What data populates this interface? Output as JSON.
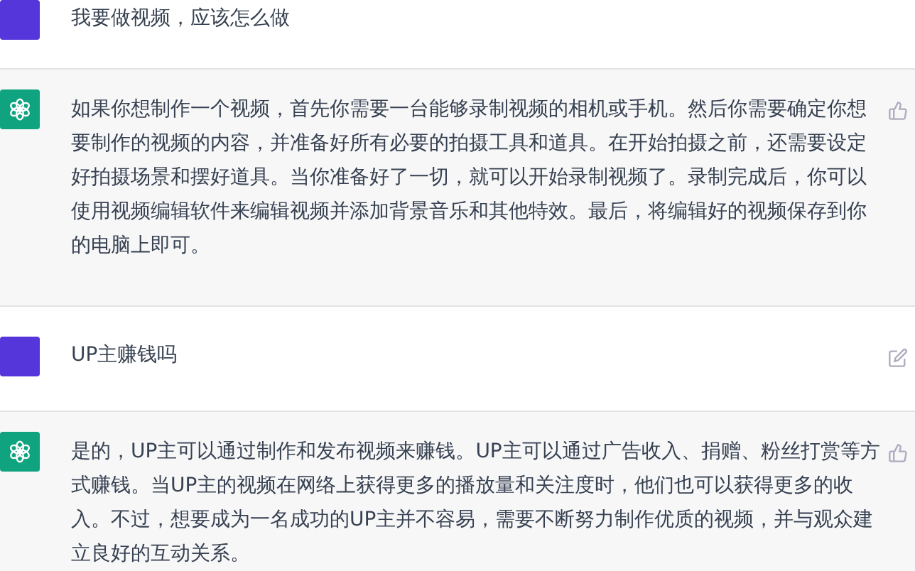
{
  "messages": [
    {
      "kind": "user",
      "text": "我要做视频，应该怎么做",
      "edit_button": false
    },
    {
      "kind": "assistant",
      "text": "如果你想制作一个视频，首先你需要一台能够录制视频的相机或手机。然后你需要确定你想要制作的视频的内容，并准备好所有必要的拍摄工具和道具。在开始拍摄之前，还需要设定好拍摄场景和摆好道具。当你准备好了一切，就可以开始录制视频了。录制完成后，你可以使用视频编辑软件来编辑视频并添加背景音乐和其他特效。最后，将编辑好的视频保存到你的电脑上即可。"
    },
    {
      "kind": "user",
      "text": "UP主赚钱吗",
      "edit_button": true
    },
    {
      "kind": "assistant",
      "text": "是的，UP主可以通过制作和发布视频来赚钱。UP主可以通过广告收入、捐赠、粉丝打赏等方式赚钱。当UP主的视频在网络上获得更多的播放量和关注度时，他们也可以获得更多的收入。不过，想要成为一名成功的UP主并不容易，需要不断努力制作优质的视频，并与观众建立良好的互动关系。"
    }
  ]
}
